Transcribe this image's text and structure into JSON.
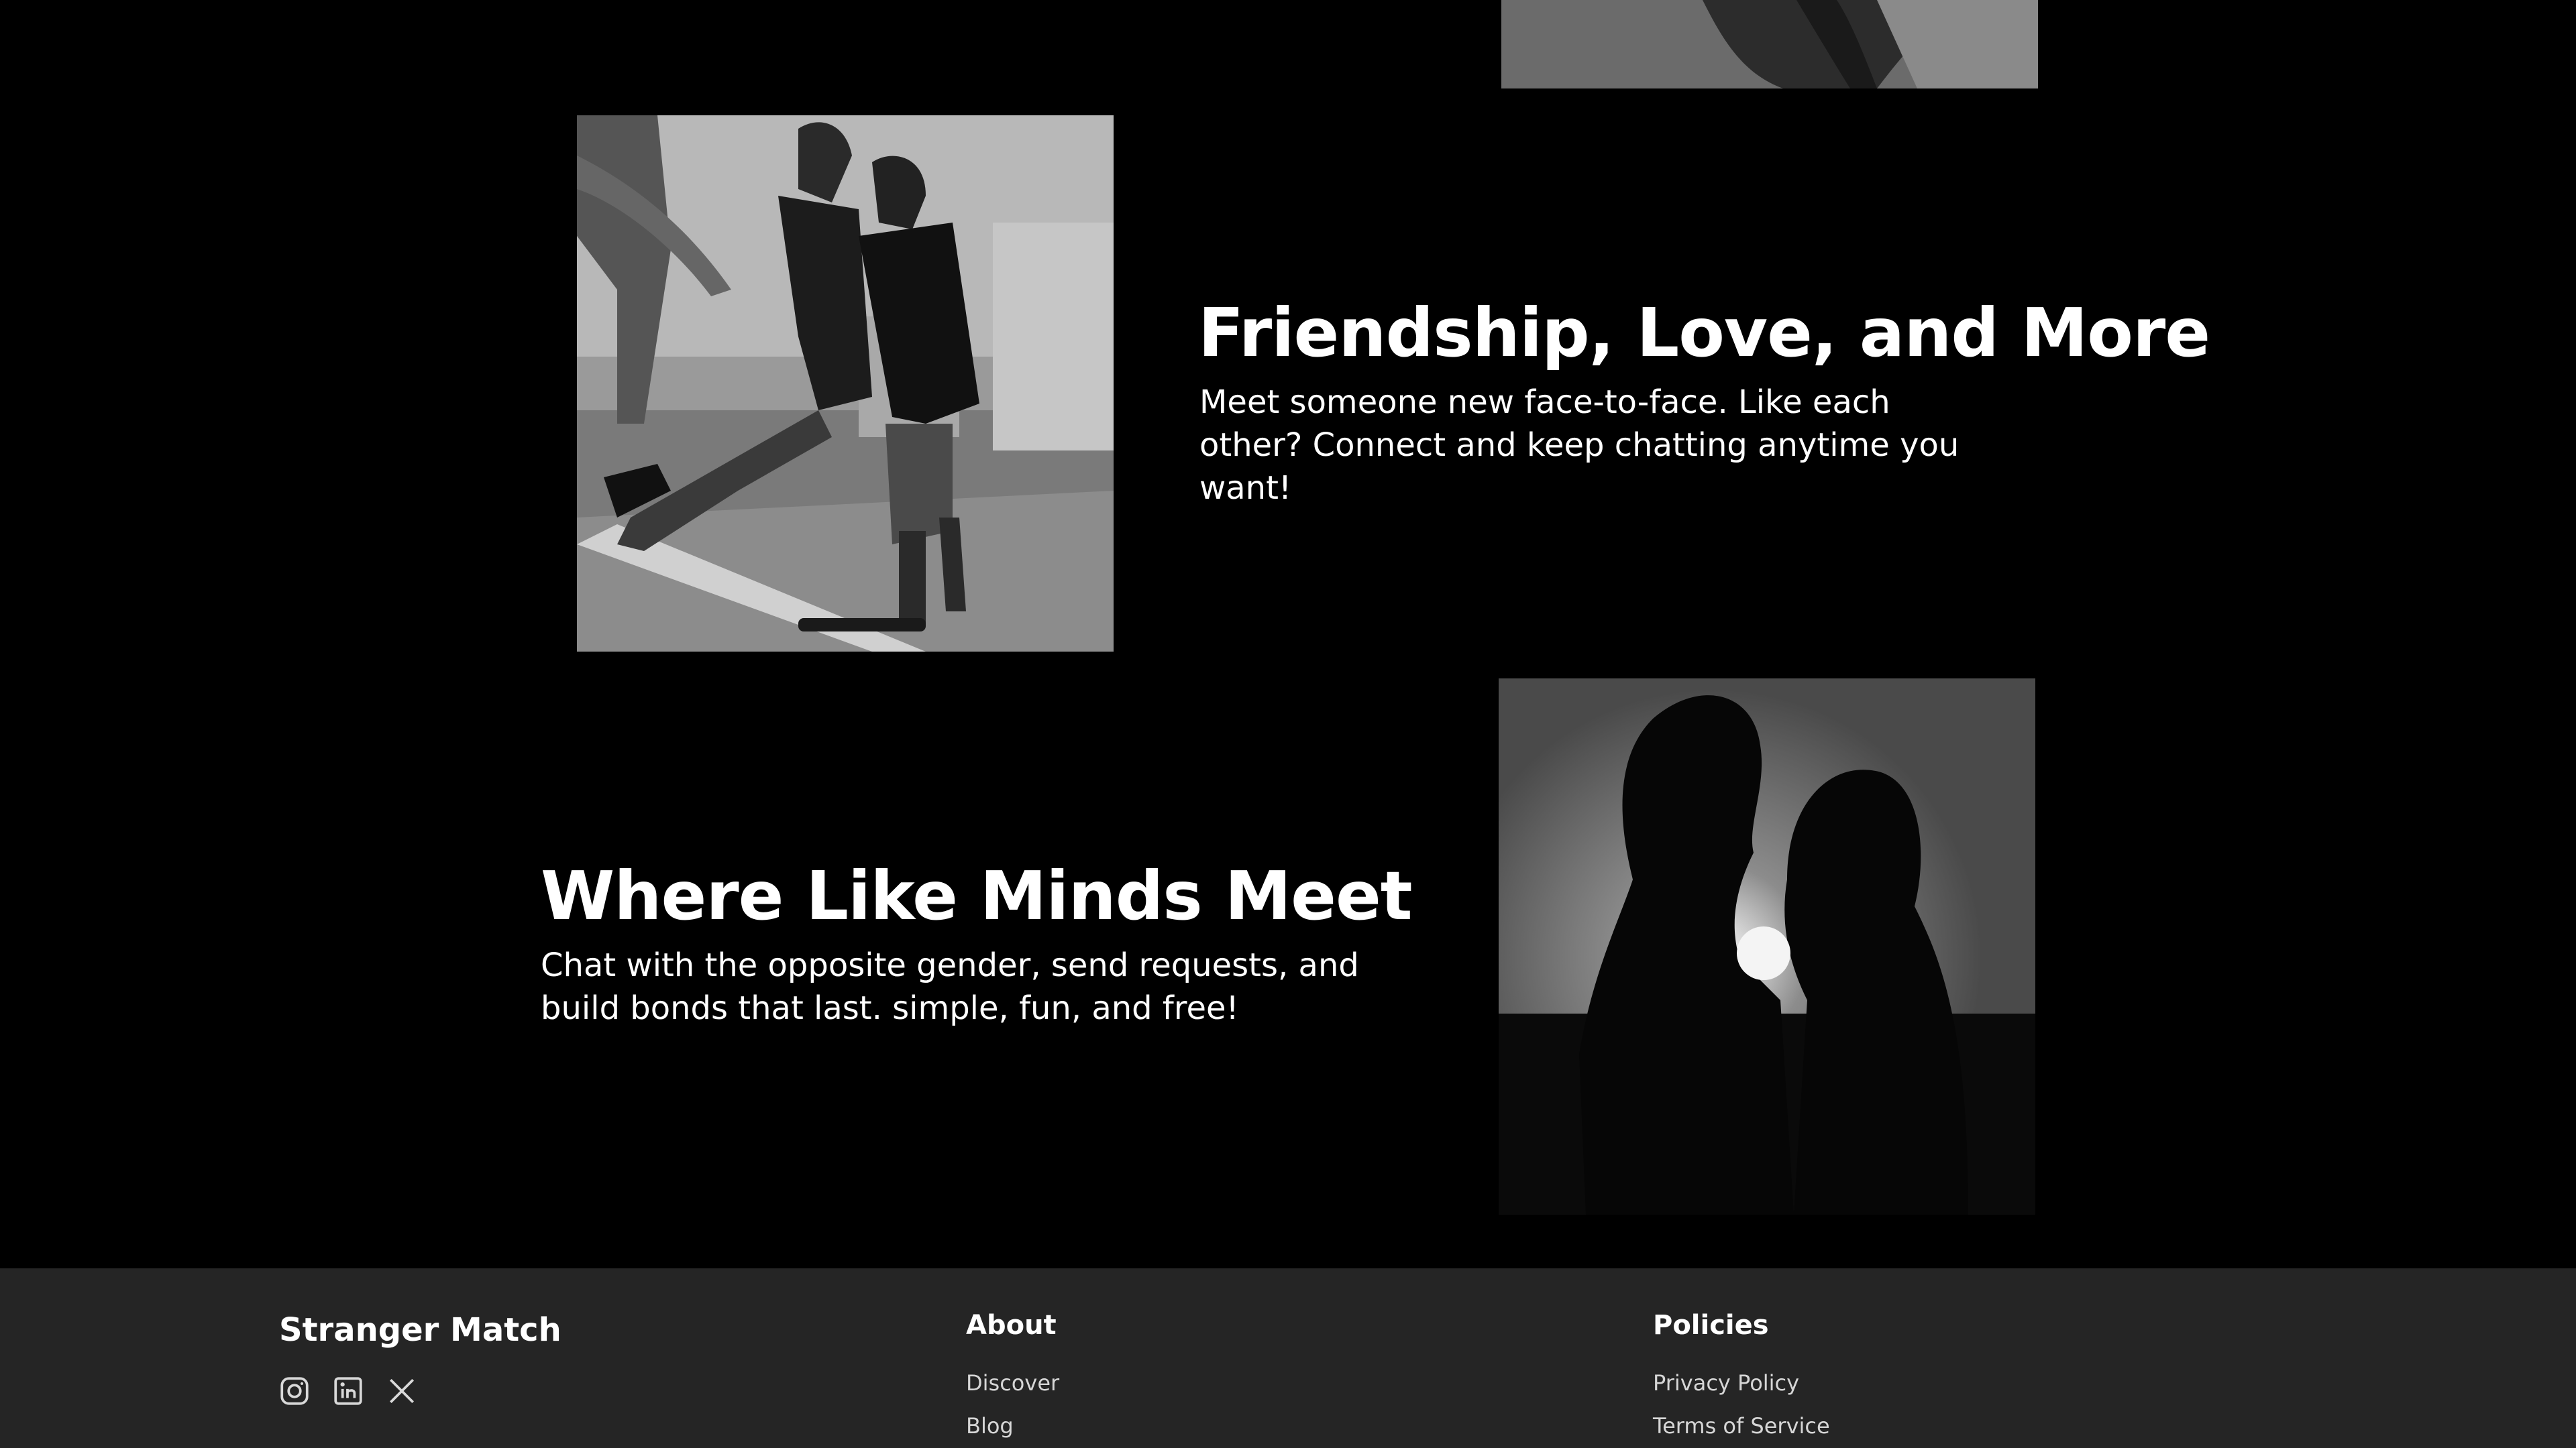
{
  "features": [
    {
      "title": "Friendship, Love, and More",
      "text": "Meet someone new face-to-face. Like each other? Connect and keep chatting anytime you want!",
      "image": "couple-skating-photo"
    },
    {
      "title": "Where Like Minds Meet",
      "text": "Chat with the opposite gender, send requests, and build bonds that last. simple, fun, and free!",
      "image": "couple-kissing-silhouette-photo"
    }
  ],
  "footer": {
    "brand": "Stranger Match",
    "social_icons": [
      "instagram-icon",
      "linkedin-icon",
      "x-icon"
    ],
    "about": {
      "title": "About",
      "links": [
        "Discover",
        "Blog"
      ]
    },
    "policies": {
      "title": "Policies",
      "links": [
        "Privacy Policy",
        "Terms of Service"
      ]
    }
  },
  "colors": {
    "background": "#000000",
    "footer_background": "#252525",
    "text": "#ffffff"
  }
}
